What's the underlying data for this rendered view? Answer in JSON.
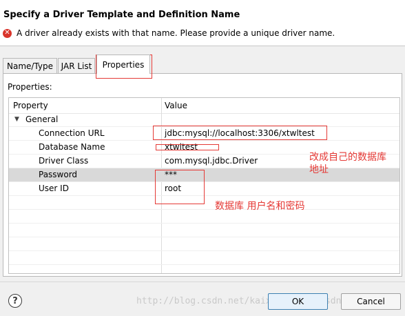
{
  "dialog": {
    "title": "Specify a Driver Template and Definition Name",
    "error_message": "A driver already exists with that name. Please provide a unique driver name."
  },
  "tabs": [
    {
      "label": "Name/Type"
    },
    {
      "label": "JAR List"
    },
    {
      "label": "Properties",
      "active": true
    }
  ],
  "properties": {
    "section_label": "Properties:",
    "columns": [
      "Property",
      "Value"
    ],
    "group": "General",
    "rows": [
      {
        "property": "Connection URL",
        "value": "jdbc:mysql://localhost:3306/xtwltest"
      },
      {
        "property": "Database Name",
        "value": "xtwltest"
      },
      {
        "property": "Driver Class",
        "value": "com.mysql.jdbc.Driver"
      },
      {
        "property": "Password",
        "value": "***",
        "selected": true
      },
      {
        "property": "User ID",
        "value": "root"
      }
    ]
  },
  "annotations": {
    "note1_line1": "改成自己的数据库",
    "note1_line2": "地址",
    "note2": "数据库 用户名和密码",
    "color": "#e53935"
  },
  "footer": {
    "help_icon": "?",
    "watermark": "http://blog.csdn.net/kaixin123456_csdn",
    "ok_label": "OK",
    "cancel_label": "Cancel"
  }
}
